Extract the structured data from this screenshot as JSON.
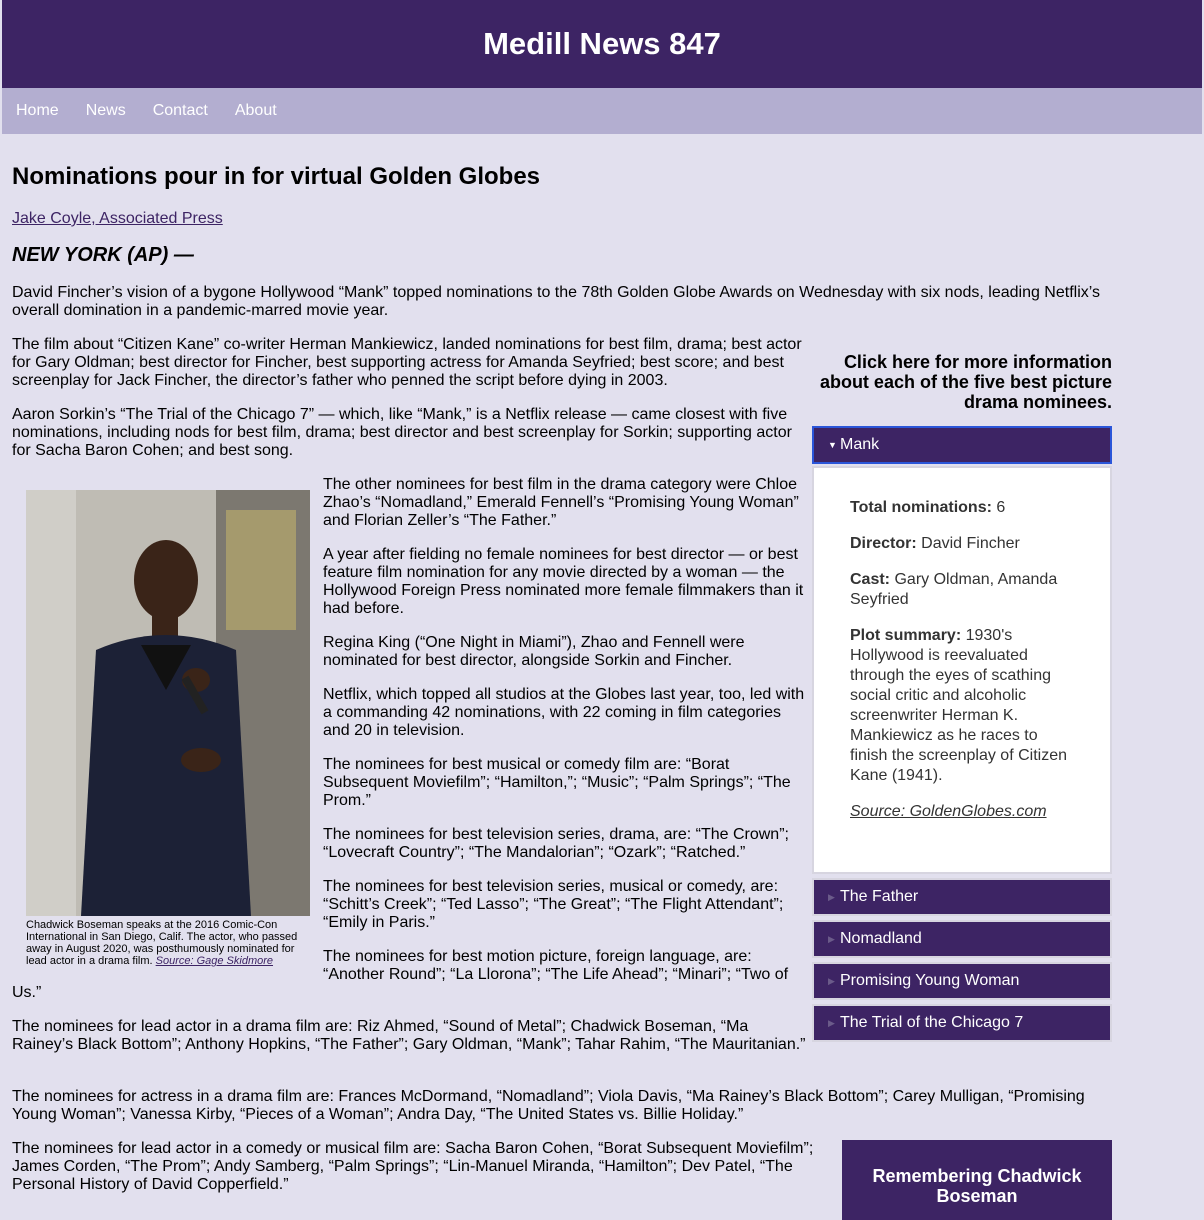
{
  "site": {
    "title": "Medill News 847"
  },
  "nav": [
    "Home",
    "News",
    "Contact",
    "About"
  ],
  "article": {
    "title": "Nominations pour in for virtual Golden Globes",
    "byline": "Jake Coyle, Associated Press",
    "dateline": "NEW YORK (AP) —",
    "p1": "David Fincher’s vision of a bygone Hollywood “Mank” topped nominations to the 78th Golden Globe Awards on Wednesday with six nods, leading Netflix’s overall domination in a pandemic-marred movie year.",
    "p2": "The film about “Citizen Kane” co-writer Herman Mankiewicz, landed nominations for best film, drama; best actor for Gary Oldman; best director for Fincher, best supporting actress for Amanda Seyfried; best score; and best screenplay for Jack Fincher, the director’s father who penned the script before dying in 2003.",
    "p3": "Aaron Sorkin’s “The Trial of the Chicago 7” — which, like “Mank,” is a Netflix release — came closest with five nominations, including nods for best film, drama; best director and best screenplay for Sorkin; supporting actor for Sacha Baron Cohen; and best song.",
    "p4": "The other nominees for best film in the drama category were Chloe Zhao’s “Nomadland,” Emerald Fennell’s “Promising Young Woman” and Florian Zeller’s “The Father.”",
    "p5": "A year after fielding no female nominees for best director — or best feature film nomination for any movie directed by a woman — the Hollywood Foreign Press nominated more female filmmakers than it had before.",
    "p6": "Regina King (“One Night in Miami”), Zhao and Fennell were nominated for best director, alongside Sorkin and Fincher.",
    "p7": "Netflix, which topped all studios at the Globes last year, too, led with a commanding 42 nominations, with 22 coming in film categories and 20 in television.",
    "p8": "The nominees for best musical or comedy film are: “Borat Subsequent Moviefilm”; “Hamilton,”; “Music”; “Palm Springs”; “The Prom.”",
    "p9": "The nominees for best television series, drama, are: “The Crown”; “Lovecraft Country”; “The Mandalorian”; “Ozark”; “Ratched.”",
    "p10": "The nominees for best television series, musical or comedy, are: “Schitt’s Creek”; “Ted Lasso”; “The Great”; “The Flight Attendant”; “Emily in Paris.”",
    "p11a": "The nominees for best motion picture, foreign language, are: “Another Round”; “La Llorona”; “The Life Ahead”; “Minari”; “Two of",
    "p11b": "Us.”",
    "p12": "The nominees for lead actor in a drama film are: Riz Ahmed, “Sound of Metal”; Chadwick Boseman, “Ma Rainey’s Black Bottom”; Anthony Hopkins, “The Father”; Gary Oldman, “Mank”; Tahar Rahim, “The Mauritanian.”",
    "p13": "The nominees for actress in a drama film are: Frances McDormand, “Nomadland”; Viola Davis, “Ma Rainey’s Black Bottom”; Carey Mulligan, “Promising Young Woman”; Vanessa Kirby, “Pieces of a Woman”; Andra Day, “The United States vs. Billie Holiday.”",
    "p14": "The nominees for lead actor in a comedy or musical film are: Sacha Baron Cohen, “Borat Subsequent Moviefilm”; James Corden, “The Prom”; Andy Samberg, “Palm Springs”; “Lin-Manuel Miranda, “Hamilton”; Dev Patel, “The Personal History of David Copperfield.”"
  },
  "photo": {
    "caption": "Chadwick Boseman speaks at the 2016 Comic-Con International in San Diego, Calif. The actor, who passed away in August 2020, was posthumously nominated for lead actor in a drama film.",
    "source": "Source: Gage Skidmore"
  },
  "sidebar": {
    "heading": "Click here for more information about each of the five best picture drama nominees.",
    "items": [
      {
        "label": "Mank",
        "expanded": true
      },
      {
        "label": "The Father",
        "expanded": false
      },
      {
        "label": "Nomadland",
        "expanded": false
      },
      {
        "label": "Promising Young Woman",
        "expanded": false
      },
      {
        "label": "The Trial of the Chicago 7",
        "expanded": false
      }
    ],
    "mank": {
      "nominations_label": "Total nominations:",
      "nominations": "6",
      "director_label": "Director:",
      "director": "David Fincher",
      "cast_label": "Cast:",
      "cast": "Gary Oldman, Amanda Seyfried",
      "plot_label": "Plot summary:",
      "plot": "1930's Hollywood is reevaluated through the eyes of scathing social critic and alcoholic screenwriter Herman K. Mankiewicz as he races to finish the screenplay of Citizen Kane (1941).",
      "source": "Source: GoldenGlobes.com"
    },
    "remember": "Remembering Chadwick Boseman"
  },
  "colors": {
    "header": "#3d2464",
    "nav": "#b3aed0",
    "background": "#e2e0ee"
  }
}
